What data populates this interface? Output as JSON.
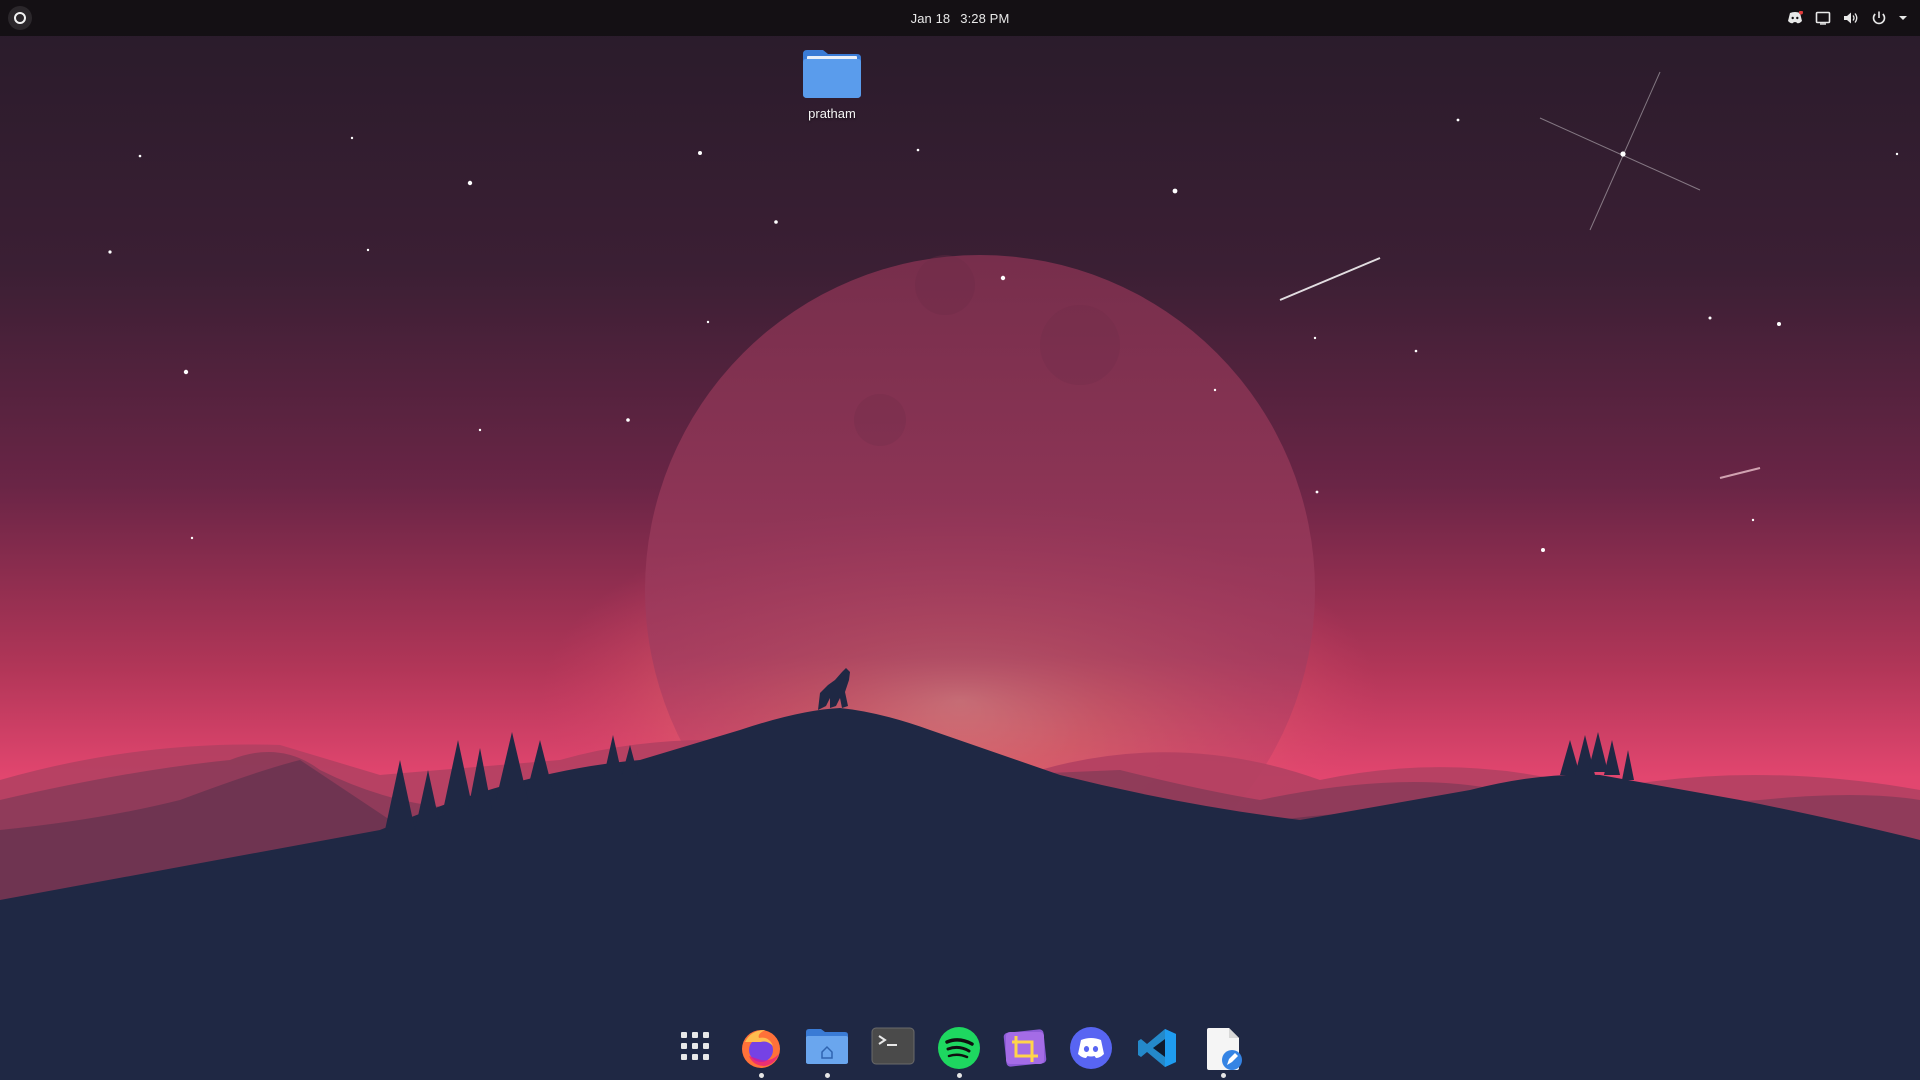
{
  "topbar": {
    "activities_icon": "activities-ring-icon",
    "date": "Jan 18",
    "time": "3:28 PM",
    "tray": [
      {
        "name": "discord-tray-icon",
        "icon": "discord-icon"
      },
      {
        "name": "screen-icon",
        "icon": "display-icon"
      },
      {
        "name": "volume-icon",
        "icon": "speaker-icon"
      },
      {
        "name": "power-icon",
        "icon": "power-icon"
      },
      {
        "name": "system-menu-chevron-icon",
        "icon": "chevron-down-icon"
      }
    ]
  },
  "desktop": {
    "icons": [
      {
        "label": "pratham",
        "icon": "folder-icon"
      }
    ]
  },
  "dock": {
    "items": [
      {
        "name": "show-apps",
        "icon": "grid-icon",
        "running": false
      },
      {
        "name": "firefox",
        "icon": "firefox-icon",
        "running": true
      },
      {
        "name": "files",
        "icon": "folder-home-icon",
        "running": true
      },
      {
        "name": "terminal",
        "icon": "terminal-icon",
        "running": false
      },
      {
        "name": "spotify",
        "icon": "spotify-icon",
        "running": true
      },
      {
        "name": "screenshot-tool",
        "icon": "crop-icon",
        "running": false
      },
      {
        "name": "discord",
        "icon": "discord-icon",
        "running": false
      },
      {
        "name": "vscode",
        "icon": "vscode-icon",
        "running": false
      },
      {
        "name": "text-editor",
        "icon": "text-editor-icon",
        "running": true
      }
    ]
  },
  "colors": {
    "topbar_bg": "#141014",
    "sky_top": "#2a1b2b",
    "sky_mid": "#6b2545",
    "sky_horizon": "#e2466f",
    "glow": "#f7b68a",
    "mountain_front": "#1f2844",
    "accent_folder": "#4a8fe0"
  }
}
